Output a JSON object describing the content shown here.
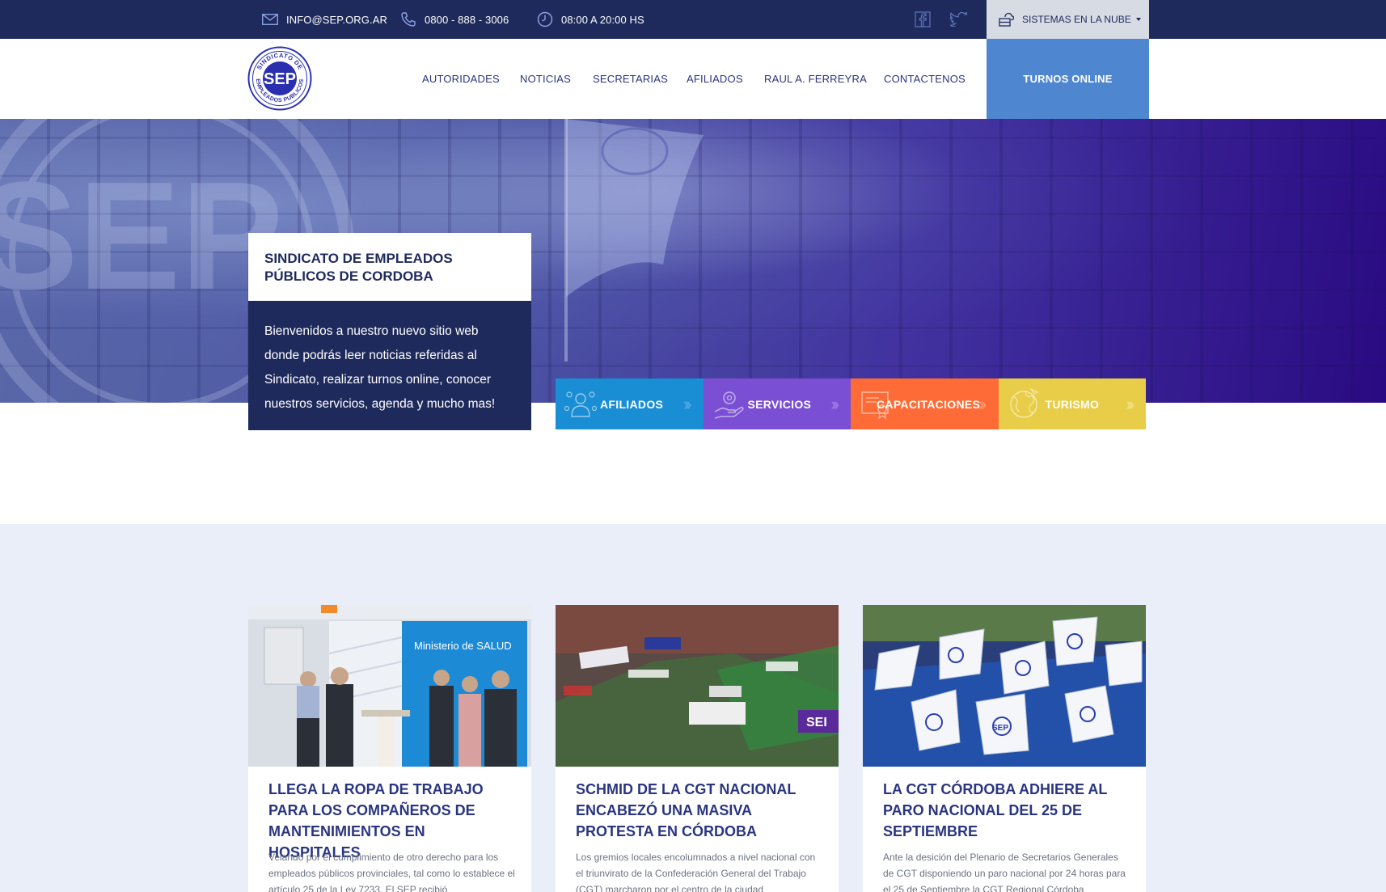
{
  "topbar": {
    "email": "INFO@SEP.ORG.AR",
    "phone": "0800 - 888 - 3006",
    "hours": "08:00 A 20:00 HS",
    "cloud_menu": "SISTEMAS EN LA NUBE"
  },
  "logo": {
    "top_text": "SINDICATO DE",
    "center_text": "SEP",
    "bottom_text": "EMPLEADOS PUBLICOS"
  },
  "nav": {
    "items": [
      {
        "label": "AUTORIDADES"
      },
      {
        "label": "NOTICIAS"
      },
      {
        "label": "SECRETARIAS"
      },
      {
        "label": "AFILIADOS"
      },
      {
        "label": "RAUL A. FERREYRA"
      },
      {
        "label": "CONTACTENOS"
      }
    ],
    "cta": "TURNOS ONLINE"
  },
  "hero": {
    "title": "SINDICATO DE EMPLEADOS PÚBLICOS DE CORDOBA",
    "body": "Bienvenidos a nuestro nuevo sitio web donde podrás leer noticias referidas al Sindicato, realizar turnos online, conocer nuestros servicios, agenda y mucho mas!",
    "tiles": [
      {
        "label": "AFILIADOS",
        "icon": "people-icon",
        "color": "#1a8ed4"
      },
      {
        "label": "SERVICIOS",
        "icon": "hand-gear-icon",
        "color": "#7b4fd3"
      },
      {
        "label": "CAPACITACIONES",
        "icon": "certificate-icon",
        "color": "#ff6b36"
      },
      {
        "label": "TURISMO",
        "icon": "globe-icon",
        "color": "#e8cd48"
      }
    ]
  },
  "news": [
    {
      "title": "LLEGA LA ROPA DE TRABAJO PARA LOS COMPAÑEROS DE MANTENIMIENTOS EN HOSPITALES",
      "excerpt": "Velando por el cumplimiento de otro derecho para los empleados públicos provinciales, tal como lo establece el artículo 25 de la Ley 7233. El SEP recibió",
      "photo_sign": "Ministerio de SALUD"
    },
    {
      "title": "SCHMID DE LA CGT NACIONAL ENCABEZÓ UNA MASIVA PROTESTA EN CÓRDOBA",
      "excerpt": "Los gremios locales encolumnados a nivel nacional con el triunvirato de la Confederación General del Trabajo (CGT) marcharon por el centro de la ciudad",
      "photo_sign": "SEI"
    },
    {
      "title": "LA CGT CÓRDOBA ADHIERE AL PARO NACIONAL DEL 25 DE SEPTIEMBRE",
      "excerpt": "Ante la desición del Plenario de Secretarios Generales de CGT disponiendo un paro nacional por 24 horas para el 25 de Septiembre la CGT Regional Córdoba",
      "photo_sign": "SEP"
    }
  ],
  "colors": {
    "navy": "#1f2a5c",
    "turnos": "#4f86d0",
    "news_bg": "#e9eef8"
  }
}
